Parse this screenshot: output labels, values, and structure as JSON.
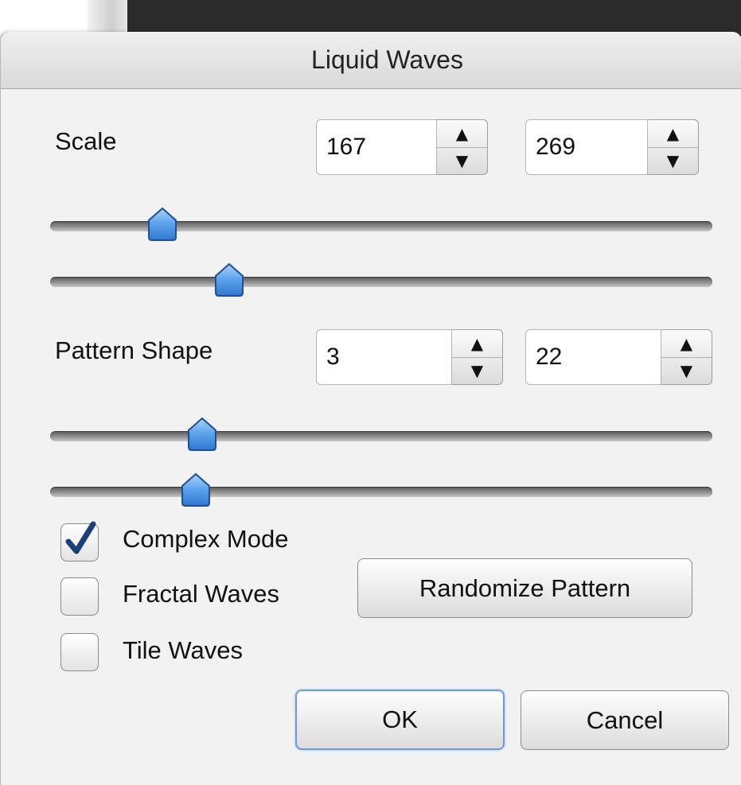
{
  "dialog": {
    "title": "Liquid Waves"
  },
  "scale": {
    "label": "Scale",
    "value1": "167",
    "value2": "269",
    "slider1_fraction": 0.17,
    "slider2_fraction": 0.27
  },
  "pattern_shape": {
    "label": "Pattern Shape",
    "value1": "3",
    "value2": "22",
    "slider1_fraction": 0.23,
    "slider2_fraction": 0.22
  },
  "options": {
    "complex_mode": {
      "label": "Complex Mode",
      "checked": true
    },
    "fractal_waves": {
      "label": "Fractal Waves",
      "checked": false
    },
    "tile_waves": {
      "label": "Tile Waves",
      "checked": false
    }
  },
  "buttons": {
    "randomize": "Randomize Pattern",
    "ok": "OK",
    "cancel": "Cancel"
  },
  "icons": {
    "spin_up": "▲",
    "spin_down": "▼"
  },
  "colors": {
    "accent": "#3d7fd6",
    "thumb_light": "#8fc3f5",
    "default_button_border": "#6b9bd0"
  }
}
